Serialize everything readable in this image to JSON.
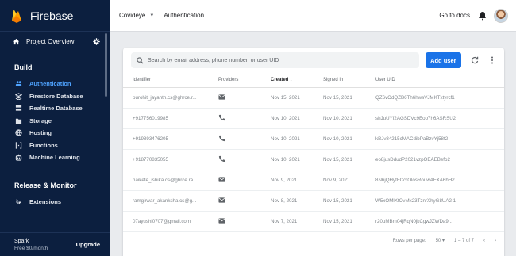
{
  "sidebar": {
    "brand": "Firebase",
    "project_overview": "Project Overview",
    "build_title": "Build",
    "build_items": [
      {
        "label": "Authentication",
        "icon": "people-icon",
        "active": true
      },
      {
        "label": "Firestore Database",
        "icon": "firestore-icon",
        "active": false
      },
      {
        "label": "Realtime Database",
        "icon": "database-icon",
        "active": false
      },
      {
        "label": "Storage",
        "icon": "folder-icon",
        "active": false
      },
      {
        "label": "Hosting",
        "icon": "globe-icon",
        "active": false
      },
      {
        "label": "Functions",
        "icon": "functions-icon",
        "active": false
      },
      {
        "label": "Machine Learning",
        "icon": "robot-icon",
        "active": false
      }
    ],
    "release_title": "Release & Monitor",
    "extensions": "Extensions",
    "plan_name": "Spark",
    "plan_price": "Free $0/month",
    "upgrade": "Upgrade"
  },
  "topbar": {
    "project": "Covideye",
    "page": "Authentication",
    "docs": "Go to docs"
  },
  "search": {
    "placeholder": "Search by email address, phone number, or user UID"
  },
  "add_user": "Add user",
  "table": {
    "headers": {
      "identifier": "Identifier",
      "providers": "Providers",
      "created": "Created",
      "signed_in": "Signed In",
      "uid": "User UID"
    },
    "rows": [
      {
        "identifier": "purohit_jayanth.cs@ghrce.r...",
        "provider": "email",
        "created": "Nov 15, 2021",
        "signed_in": "Nov 15, 2021",
        "uid": "QZ6vOdQZB6Th6hwsVJMKTxtyrcf1"
      },
      {
        "identifier": "+917756019985",
        "provider": "phone",
        "created": "Nov 10, 2021",
        "signed_in": "Nov 10, 2021",
        "uid": "shJuUYf2AGSDVc9Eoo7h6ASRSU2"
      },
      {
        "identifier": "+919893476205",
        "provider": "phone",
        "created": "Nov 10, 2021",
        "signed_in": "Nov 10, 2021",
        "uid": "kBJv84215cMACdibPaBzvYj58t2"
      },
      {
        "identifier": "+918770835055",
        "provider": "phone",
        "created": "Nov 10, 2021",
        "signed_in": "Nov 15, 2021",
        "uid": "eo8jusDdudP2021vzpOEAEBefo2"
      },
      {
        "identifier": "naikete_ishika.cs@ghrce.ra...",
        "provider": "email",
        "created": "Nov 9, 2021",
        "signed_in": "Nov 9, 2021",
        "uid": "8N6jQHytFCcrOlosRouwAFXA6hH2"
      },
      {
        "identifier": "ramgirwar_akanksha.cs@g...",
        "provider": "email",
        "created": "Nov 8, 2021",
        "signed_in": "Nov 15, 2021",
        "uid": "W5xOMlXtOvMx23TznrXhyG8UA2I1"
      },
      {
        "identifier": "07ayushi0707@gmail.com",
        "provider": "email",
        "created": "Nov 7, 2021",
        "signed_in": "Nov 15, 2021",
        "uid": "r20uMBm04jRqN0jkCgwJZWDa9..."
      }
    ]
  },
  "pagination": {
    "rows_per_page_label": "Rows per page:",
    "rows_per_page": "50",
    "range": "1 – 7 of 7"
  }
}
